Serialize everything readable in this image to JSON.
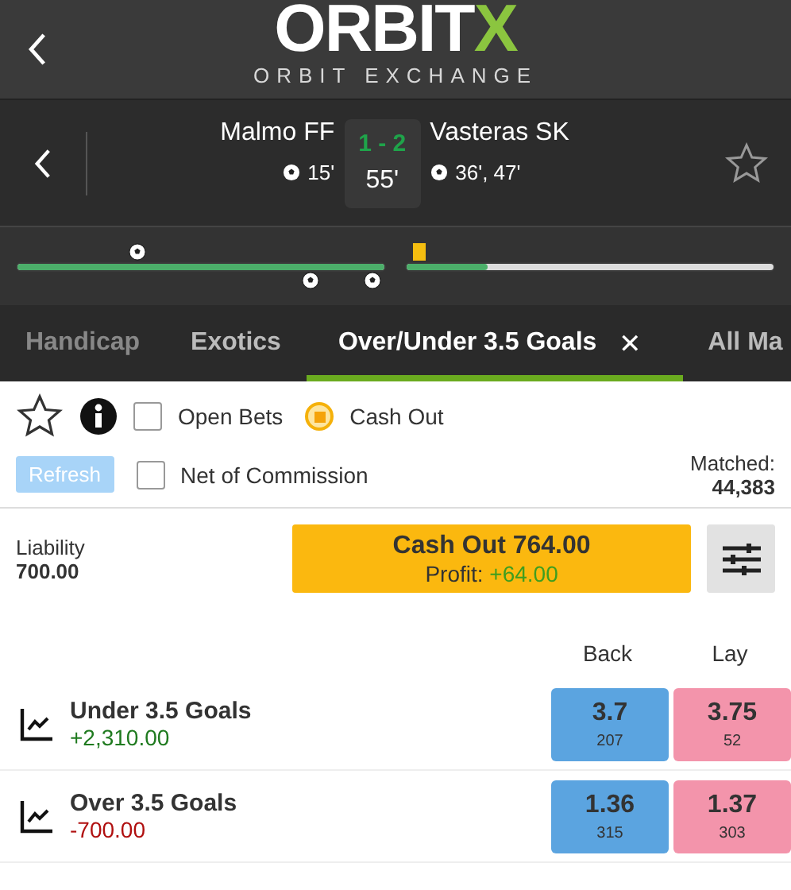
{
  "header": {
    "logo": "ORBIT",
    "logo_accent": "X",
    "subtitle": "ORBIT EXCHANGE"
  },
  "match": {
    "home": "Malmo FF",
    "away": "Vasteras SK",
    "score": "1 - 2",
    "minute": "55'",
    "home_goals": "15'",
    "away_goals": "36', 47'",
    "favourite": false
  },
  "timeline": {
    "first_half": {
      "level": 1
    },
    "second_half": {
      "level": 0.22
    }
  },
  "tabs": [
    {
      "label": "Handicap",
      "selected": false
    },
    {
      "label": "Exotics",
      "selected": false
    },
    {
      "label": "Over/Under 3.5 Goals",
      "selected": true,
      "close": "✕"
    },
    {
      "label": "All Ma",
      "selected": false
    }
  ],
  "toolbar": {
    "favourite": false,
    "options": [
      {
        "kind": "checkbox",
        "label": "Open Bets",
        "checked": false
      },
      {
        "kind": "radio",
        "label": "Cash Out",
        "checked": true
      }
    ],
    "refresh": "Refresh",
    "net_commission": {
      "label": "Net of Commission",
      "checked": false
    },
    "matched_label": "Matched:",
    "matched": "44,383"
  },
  "cashout": {
    "liability_label": "Liability",
    "liability": "700.00",
    "button": "Cash Out 764.00",
    "profit_label": "Profit:",
    "profit": "+64.00"
  },
  "market": {
    "columns": [
      "Back",
      "Lay"
    ],
    "runners": [
      {
        "name": "Under 3.5 Goals",
        "pnl": "+2,310.00",
        "positive": true,
        "back": {
          "price": "3.7",
          "size": "207"
        },
        "lay": {
          "price": "3.75",
          "size": "52"
        }
      },
      {
        "name": "Over 3.5 Goals",
        "pnl": "-700.00",
        "positive": false,
        "back": {
          "price": "1.36",
          "size": "315"
        },
        "lay": {
          "price": "1.37",
          "size": "303"
        }
      }
    ]
  }
}
